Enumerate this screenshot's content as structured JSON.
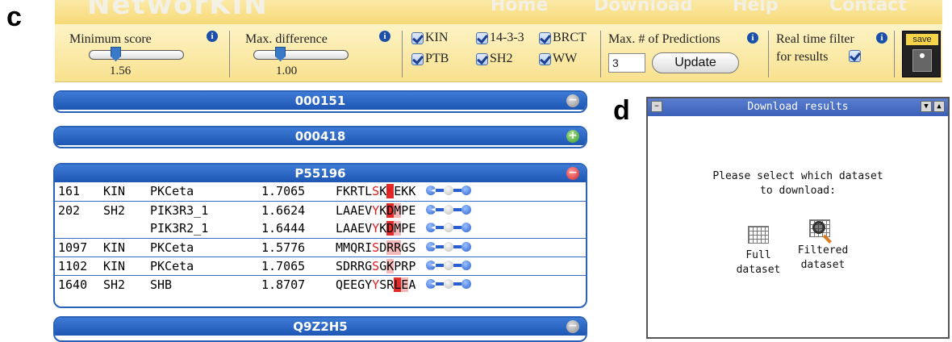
{
  "panel_letters": {
    "c": "c",
    "d": "d"
  },
  "topnav": {
    "brand": "NetworKIN",
    "items": [
      "Home",
      "Download",
      "Help",
      "Contact"
    ]
  },
  "filters": {
    "min_score": {
      "label": "Minimum score",
      "value": "1.56",
      "slider_fraction": 0.28
    },
    "max_difference": {
      "label": "Max. difference",
      "value": "1.00",
      "slider_fraction": 0.28
    },
    "checkboxes": [
      {
        "label": "KIN",
        "checked": true
      },
      {
        "label": "14-3-3",
        "checked": true
      },
      {
        "label": "BRCT",
        "checked": true
      },
      {
        "label": "PTB",
        "checked": true
      },
      {
        "label": "SH2",
        "checked": true
      },
      {
        "label": "WW",
        "checked": true
      }
    ],
    "max_predictions": {
      "label": "Max. # of Predictions",
      "value": "3",
      "button": "Update"
    },
    "realtime": {
      "line1": "Real time filter",
      "line2": "for results",
      "checked": true
    },
    "save_label": "save"
  },
  "proteins": [
    {
      "id": "000151",
      "state": "collapsed-minus"
    },
    {
      "id": "000418",
      "state": "collapsed-plus"
    },
    {
      "id": "P55196",
      "state": "expanded",
      "rows": [
        {
          "pos": "161",
          "type": "KIN",
          "predictor": "PKCeta",
          "score": "1.7065",
          "seq": "FKRTLSKKEKK"
        },
        {
          "pos": "202",
          "type": "SH2",
          "predictor": "PIK3R3_1",
          "score": "1.6624",
          "seq": "LAAEVYKDMPE"
        },
        {
          "pos": "",
          "type": "",
          "predictor": "PIK3R2_1",
          "score": "1.6444",
          "seq": "LAAEVYKDMPE"
        },
        {
          "pos": "1097",
          "type": "KIN",
          "predictor": "PKCeta",
          "score": "1.5776",
          "seq": "MMQRISDRRGS"
        },
        {
          "pos": "1102",
          "type": "KIN",
          "predictor": "PKCeta",
          "score": "1.7065",
          "seq": "SDRRGSGKPRP"
        },
        {
          "pos": "1640",
          "type": "SH2",
          "predictor": "SHB",
          "score": "1.8707",
          "seq": "QEEGYYSRLEA"
        }
      ]
    },
    {
      "id": "Q9Z2H5",
      "state": "collapsed-minus"
    }
  ],
  "download": {
    "title": "Download results",
    "message_line1": "Please select which dataset",
    "message_line2": "to download:",
    "options": [
      {
        "line1": "Full",
        "line2": "dataset",
        "icon": "grid-icon"
      },
      {
        "line1": "Filtered",
        "line2": "dataset",
        "icon": "magnifier-icon"
      }
    ]
  },
  "colors": {
    "panel_blue": "#1e56b4",
    "bar_yellow": "#f8e18e",
    "highlight_red": "#e22a2a"
  }
}
